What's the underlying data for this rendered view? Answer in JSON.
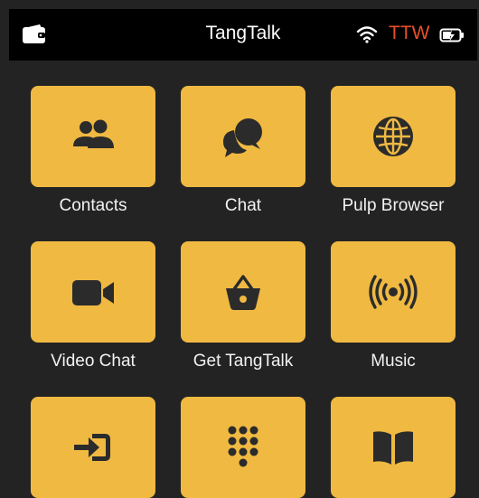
{
  "statusbar": {
    "title": "TangTalk",
    "carrier": "TTW",
    "icons": [
      "wallet-icon",
      "wifi-icon",
      "battery-charging-icon"
    ]
  },
  "apps": [
    {
      "label": "Contacts",
      "icon": "contacts-icon"
    },
    {
      "label": "Chat",
      "icon": "chat-icon"
    },
    {
      "label": "Pulp Browser",
      "icon": "globe-icon"
    },
    {
      "label": "Video Chat",
      "icon": "video-camera-icon"
    },
    {
      "label": "Get TangTalk",
      "icon": "shopping-basket-icon"
    },
    {
      "label": "Music",
      "icon": "broadcast-icon"
    },
    {
      "label": "",
      "icon": "sign-in-icon"
    },
    {
      "label": "",
      "icon": "dialpad-icon"
    },
    {
      "label": "",
      "icon": "book-icon"
    }
  ],
  "colors": {
    "background": "#232323",
    "tile": "#efb942",
    "icon": "#2b2b2b",
    "carrier": "#e8502a"
  }
}
